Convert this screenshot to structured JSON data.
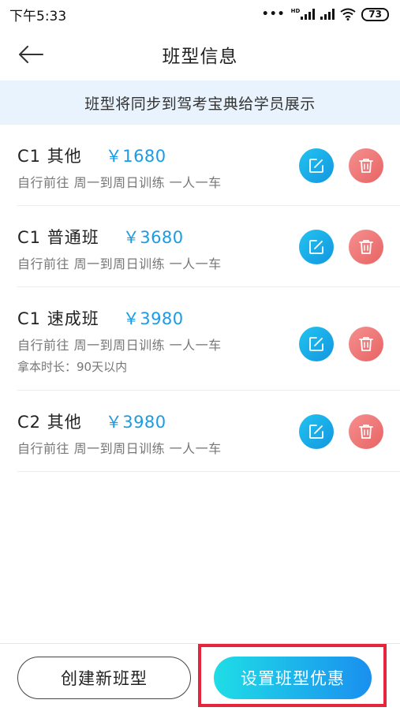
{
  "status_bar": {
    "time": "下午5:33",
    "battery": "73",
    "network_label": "HD"
  },
  "header": {
    "title": "班型信息"
  },
  "notice": {
    "text": "班型将同步到驾考宝典给学员展示"
  },
  "classes": [
    {
      "name": "C1  其他",
      "price": "￥1680",
      "desc": "自行前往  周一到周日训练  一人一车",
      "extra": ""
    },
    {
      "name": "C1  普通班",
      "price": "￥3680",
      "desc": "自行前往  周一到周日训练  一人一车",
      "extra": ""
    },
    {
      "name": "C1  速成班",
      "price": "￥3980",
      "desc": "自行前往  周一到周日训练  一人一车",
      "extra": "拿本时长：90天以内"
    },
    {
      "name": "C2  其他",
      "price": "￥3980",
      "desc": "自行前往  周一到周日训练  一人一车",
      "extra": ""
    }
  ],
  "footer": {
    "create_label": "创建新班型",
    "discount_label": "设置班型优惠"
  },
  "colors": {
    "accent_blue": "#1a9be6",
    "delete_red": "#e86464",
    "notice_bg": "#e8f3fd",
    "highlight": "#e5263a"
  }
}
